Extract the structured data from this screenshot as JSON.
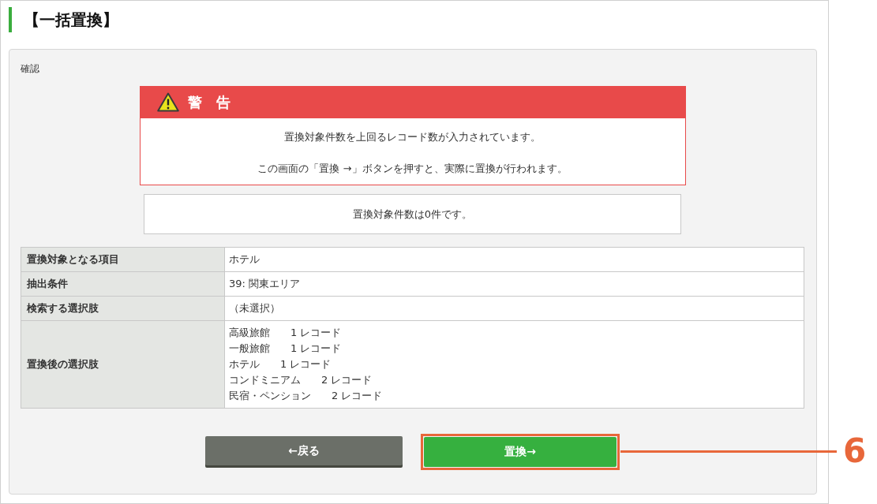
{
  "page": {
    "title": "【一括置換】"
  },
  "section": {
    "label": "確認"
  },
  "warning": {
    "title": "警　告",
    "messages": [
      "置換対象件数を上回るレコード数が入力されています。",
      "この画面の「置換 →」ボタンを押すと、実際に置換が行われます。"
    ]
  },
  "info": {
    "message": "置換対象件数は0件です。"
  },
  "details": {
    "rows": [
      {
        "label": "置換対象となる項目",
        "kind": "text",
        "value": "ホテル"
      },
      {
        "label": "抽出条件",
        "kind": "text",
        "value": "39: 関東エリア"
      },
      {
        "label": "検索する選択肢",
        "kind": "text",
        "value": "（未選択）"
      },
      {
        "label": "置換後の選択肢",
        "kind": "list",
        "items": [
          {
            "name": "高級旅館",
            "count": "1 レコード"
          },
          {
            "name": "一般旅館",
            "count": "1 レコード"
          },
          {
            "name": "ホテル",
            "count": "1 レコード"
          },
          {
            "name": "コンドミニアム",
            "count": "2 レコード"
          },
          {
            "name": "民宿・ペンション",
            "count": "2 レコード"
          }
        ]
      }
    ]
  },
  "buttons": [
    {
      "label": "←戻る",
      "kind": "back",
      "highlighted": false
    },
    {
      "label": "置換→",
      "kind": "submit",
      "highlighted": true
    }
  ],
  "callout": {
    "label": "6"
  }
}
